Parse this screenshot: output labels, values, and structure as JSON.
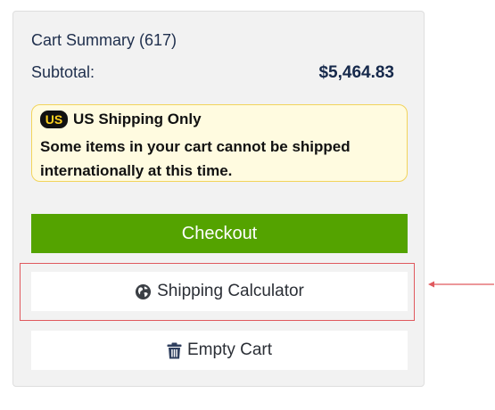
{
  "cart": {
    "title": "Cart Summary (617)",
    "subtotal_label": "Subtotal:",
    "subtotal_value": "$5,464.83"
  },
  "notice": {
    "badge": "US",
    "heading": "US Shipping Only",
    "message": "Some items in your cart cannot be shipped internationally at this time."
  },
  "buttons": {
    "checkout": "Checkout",
    "shipping_calculator": "Shipping Calculator",
    "empty_cart": "Empty Cart"
  },
  "icons": {
    "shipping_calculator": "globe-icon",
    "empty_cart": "trash-icon"
  },
  "colors": {
    "checkout_bg": "#54a300",
    "notice_bg": "#fffbe0",
    "notice_border": "#f2d45b",
    "annotation": "#e0595e",
    "price_text": "#16294b"
  }
}
